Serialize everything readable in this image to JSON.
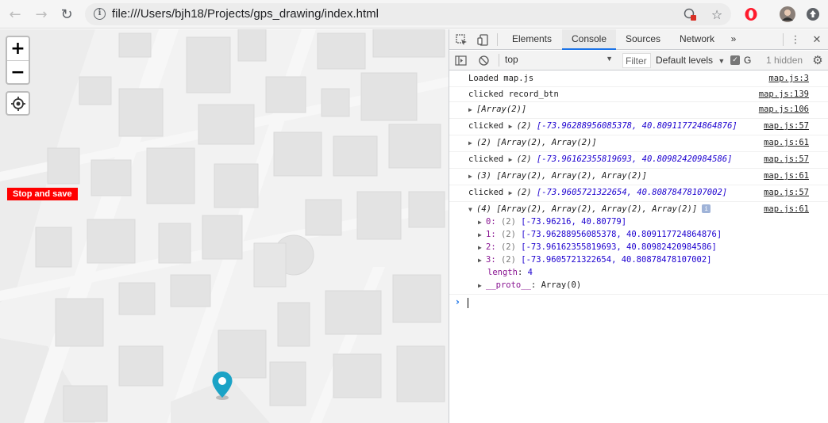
{
  "browser": {
    "url": "file:///Users/bjh18/Projects/gps_drawing/index.html",
    "back_icon": "back-arrow-icon",
    "forward_icon": "forward-arrow-icon",
    "reload_icon": "reload-icon"
  },
  "map": {
    "zoom_in_label": "+",
    "zoom_out_label": "−",
    "stop_button_label": "Stop and save",
    "stop_button_color": "#ff0000",
    "marker_color": "#1ba3c6"
  },
  "devtools": {
    "tabs": [
      "Elements",
      "Console",
      "Sources",
      "Network"
    ],
    "active_tab": "Console",
    "more_tabs": "»",
    "context": "top",
    "filter_placeholder": "Filter",
    "levels": "Default levels",
    "group_label": "G",
    "hidden": "1 hidden",
    "accent_color": "#1a73e8"
  },
  "console": {
    "rows": [
      {
        "text": "Loaded map.js",
        "source": "map.js:3"
      },
      {
        "text": "clicked record_btn",
        "source": "map.js:139"
      },
      {
        "text": "[Array(2)]",
        "source": "map.js:106"
      },
      {
        "prefix": "clicked ",
        "count": "(2)",
        "text": "[-73.96288956085378, 40.809117724864876]",
        "source": "map.js:57"
      },
      {
        "text": "(2) [Array(2), Array(2)]",
        "source": "map.js:61"
      },
      {
        "prefix": "clicked ",
        "count": "(2)",
        "text": "[-73.96162355819693, 40.80982420984586]",
        "source": "map.js:57"
      },
      {
        "text": "(3) [Array(2), Array(2), Array(2)]",
        "source": "map.js:61"
      },
      {
        "prefix": "clicked ",
        "count": "(2)",
        "text": "[-73.9605721322654, 40.80878478107002]",
        "source": "map.js:57"
      },
      {
        "text": "(4) [Array(2), Array(2), Array(2), Array(2)]",
        "source": "map.js:61"
      }
    ],
    "expanded": [
      {
        "index": "0:",
        "count": "(2)",
        "values": "[-73.96216, 40.80779]"
      },
      {
        "index": "1:",
        "count": "(2)",
        "values": "[-73.96288956085378, 40.809117724864876]"
      },
      {
        "index": "2:",
        "count": "(2)",
        "values": "[-73.96162355819693, 40.80982420984586]"
      },
      {
        "index": "3:",
        "count": "(2)",
        "values": "[-73.9605721322654, 40.80878478107002]"
      }
    ],
    "length_key": "length",
    "length_value": "4",
    "proto_key": "__proto__",
    "proto_value": "Array(0)",
    "prompt": "›"
  }
}
